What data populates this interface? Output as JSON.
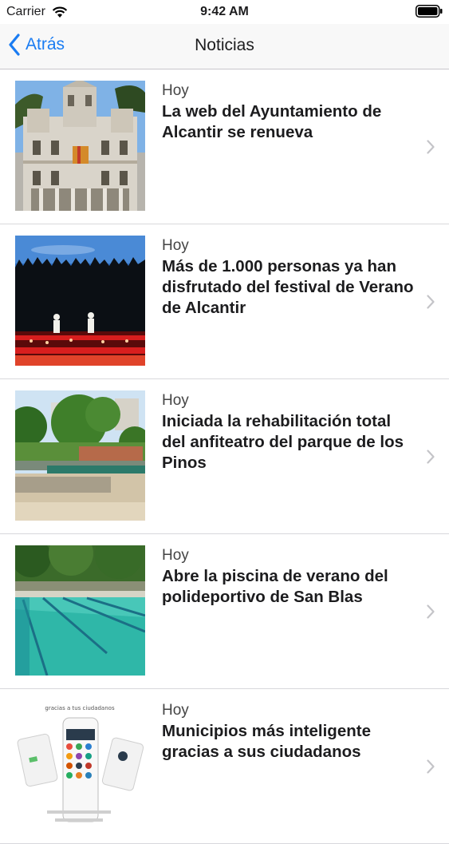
{
  "status_bar": {
    "carrier": "Carrier",
    "time": "9:42 AM"
  },
  "nav": {
    "back_label": "Atrás",
    "title": "Noticias"
  },
  "colors": {
    "accent": "#1a7cf2",
    "separator": "#d8d8dc"
  },
  "news": [
    {
      "date": "Hoy",
      "title": "La web del Ayuntamiento de Alcantir se renueva"
    },
    {
      "date": "Hoy",
      "title": "Más de 1.000 personas ya han disfrutado del festival de Verano de Alcantir"
    },
    {
      "date": "Hoy",
      "title": "Iniciada la rehabilitación total del anfiteatro del parque de los Pinos"
    },
    {
      "date": "Hoy",
      "title": "Abre la piscina de verano del polideportivo de San Blas"
    },
    {
      "date": "Hoy",
      "title": "Municipios más inteligente gracias a sus ciudadanos"
    }
  ],
  "thumb5_caption": "gracias a tus ciudadanos"
}
